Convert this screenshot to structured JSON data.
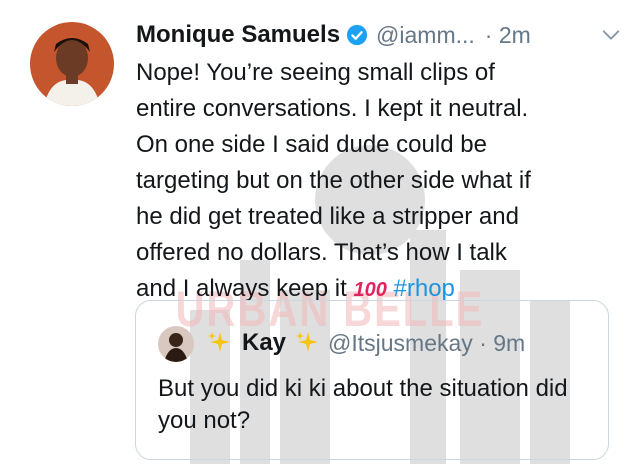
{
  "watermark": {
    "text": "URBAN BELLE"
  },
  "tweet": {
    "author_name": "Monique Samuels",
    "handle": "@iamm...",
    "time": "· 2m",
    "text": "Nope! You’re seeing small clips of\nentire conversations. I kept it neutral.\nOn one side I said dude could be\ntargeting but on the other side what if\nhe did get treated like a stripper and\noffered no dollars. That’s how I talk\nand I always keep it ",
    "emoji": "100",
    "hashtag": "#rhop"
  },
  "quoted_tweet": {
    "author_name": "Kay",
    "handle": "@Itsjusmekay · 9m",
    "text": "But you did ki ki about the situation did you not?"
  },
  "colors": {
    "link": "#1b95e0",
    "secondary_text": "#657786",
    "border": "#ccd6dd",
    "verified": "#1da1f2"
  }
}
